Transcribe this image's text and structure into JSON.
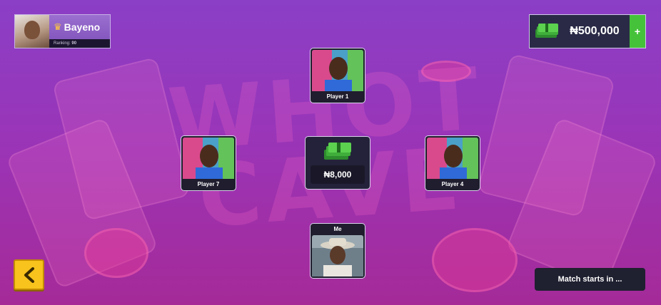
{
  "background": {
    "title_art": "WHOT CAVE"
  },
  "profile": {
    "name": "Bayeno",
    "ranking_label": "Ranking:",
    "ranking_value": "90"
  },
  "balance": {
    "amount": "₦500,000",
    "add_label": "+"
  },
  "players": {
    "top": {
      "name": "Player 1"
    },
    "left": {
      "name": "Player 7"
    },
    "right": {
      "name": "Player 4"
    },
    "bottom": {
      "name": "Me"
    }
  },
  "pot": {
    "amount": "₦8,000"
  },
  "status": {
    "text": "Match starts in ..."
  },
  "colors": {
    "accent_green": "#45c23a",
    "back_button": "#f7c31c",
    "bg_top": "#8a3fc6",
    "bg_bottom": "#a52a98"
  }
}
